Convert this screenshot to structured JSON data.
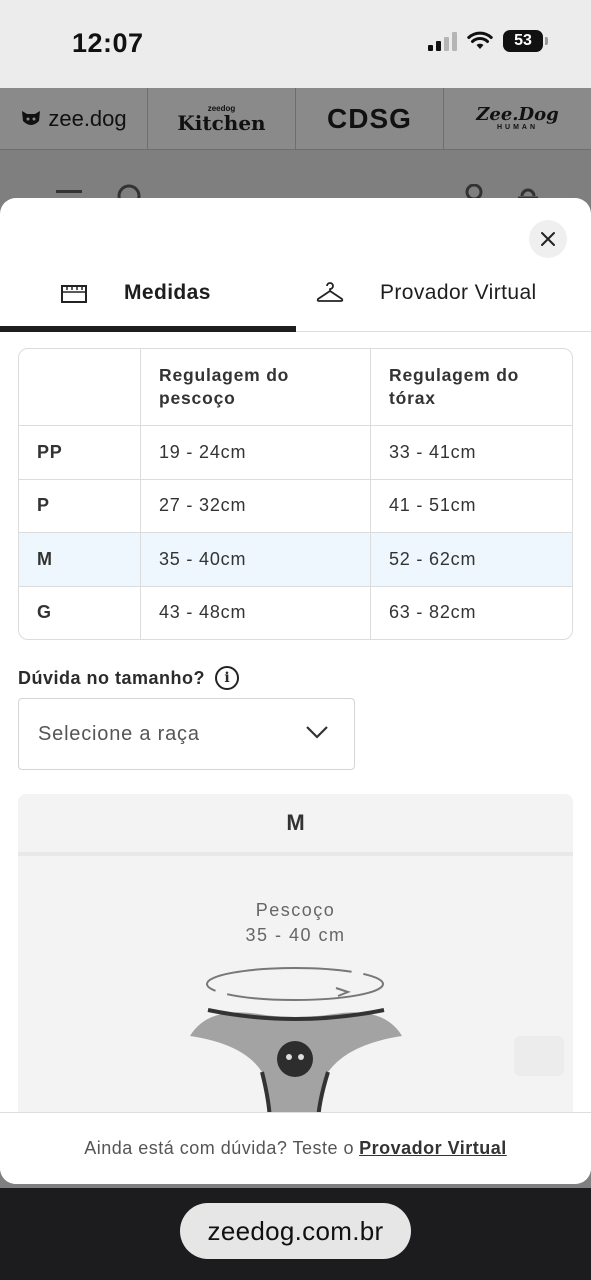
{
  "status_bar": {
    "time": "12:07",
    "battery": "53",
    "icons": [
      "cellular-signal-icon",
      "wifi-icon",
      "battery-icon"
    ]
  },
  "brands": [
    {
      "name": "zee.dog"
    },
    {
      "top": "zeedog",
      "name": "Kitchen"
    },
    {
      "name": "CDSG"
    },
    {
      "name": "Zee.Dog",
      "sub": "HUMAN"
    }
  ],
  "modal": {
    "tabs": [
      {
        "label": "Medidas",
        "icon": "ruler-icon",
        "active": true
      },
      {
        "label": "Provador Virtual",
        "icon": "hanger-icon",
        "active": false
      }
    ],
    "table": {
      "headers": [
        "",
        "Regulagem do pescoço",
        "Regulagem do tórax"
      ],
      "rows": [
        {
          "size": "PP",
          "neck": "19 - 24cm",
          "chest": "33 - 41cm"
        },
        {
          "size": "P",
          "neck": "27 - 32cm",
          "chest": "41 - 51cm"
        },
        {
          "size": "M",
          "neck": "35 - 40cm",
          "chest": "52 - 62cm"
        },
        {
          "size": "G",
          "neck": "43 - 48cm",
          "chest": "63 - 82cm"
        }
      ],
      "highlighted_size": "M"
    },
    "doubt_label": "Dúvida no tamanho?",
    "breed_select": {
      "value": "Selecione a raça"
    },
    "illustration": {
      "size": "M",
      "measure_label": "Pescoço",
      "measure_value": "35 - 40 cm"
    },
    "footer": {
      "text": "Ainda está com dúvida? Teste o",
      "link": "Provador Virtual"
    }
  },
  "browser": {
    "url": "zeedog.com.br"
  },
  "colors": {
    "highlight_row": "#eef7fd",
    "tab_indicator": "#1e1e1e"
  }
}
